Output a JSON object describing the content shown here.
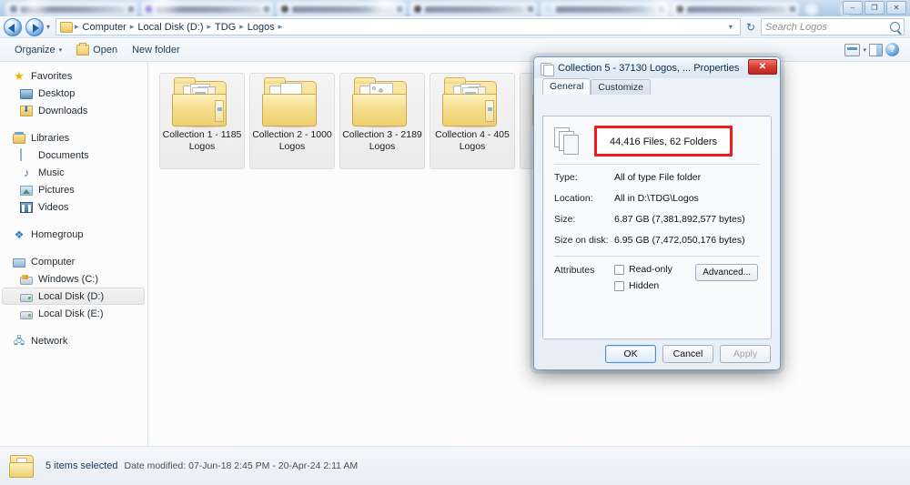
{
  "browser": {
    "window_controls": [
      "–",
      "❐",
      "✕"
    ],
    "tab_count": 6
  },
  "explorer": {
    "nav": {
      "back_icon": "back-arrow-icon",
      "forward_icon": "forward-arrow-icon",
      "history_caret": "▾",
      "breadcrumb": [
        "Computer",
        "Local Disk (D:)",
        "TDG",
        "Logos"
      ],
      "breadcrumb_separator": "▸",
      "address_caret": "▾",
      "refresh_icon": "↻",
      "search_placeholder": "Search Logos",
      "search_value": ""
    },
    "toolbar": {
      "organize_label": "Organize",
      "organize_caret": "▾",
      "open_label": "Open",
      "new_folder_label": "New folder",
      "view_caret": "▾"
    },
    "sidebar": {
      "groups": [
        {
          "header": {
            "label": "Favorites",
            "icon": "star-icon"
          },
          "items": [
            {
              "label": "Desktop",
              "icon": "desktop-icon"
            },
            {
              "label": "Downloads",
              "icon": "downloads-icon"
            }
          ]
        },
        {
          "header": {
            "label": "Libraries",
            "icon": "libraries-icon"
          },
          "items": [
            {
              "label": "Documents",
              "icon": "document-icon"
            },
            {
              "label": "Music",
              "icon": "music-icon"
            },
            {
              "label": "Pictures",
              "icon": "pictures-icon"
            },
            {
              "label": "Videos",
              "icon": "videos-icon"
            }
          ]
        },
        {
          "header": {
            "label": "Homegroup",
            "icon": "homegroup-icon"
          },
          "items": []
        },
        {
          "header": {
            "label": "Computer",
            "icon": "computer-icon"
          },
          "items": [
            {
              "label": "Windows (C:)",
              "icon": "windows-drive-icon",
              "selected": false
            },
            {
              "label": "Local Disk (D:)",
              "icon": "drive-icon",
              "selected": true
            },
            {
              "label": "Local Disk (E:)",
              "icon": "drive-icon",
              "selected": false
            }
          ]
        },
        {
          "header": {
            "label": "Network",
            "icon": "network-icon"
          },
          "items": []
        }
      ]
    },
    "items": [
      {
        "name": "Collection 1 - 1185 Logos",
        "selected": true,
        "style": "folder-with-logos"
      },
      {
        "name": "Collection 2 - 1000 Logos",
        "selected": true,
        "style": "folder-with-papers"
      },
      {
        "name": "Collection 3 - 2189 Logos",
        "selected": true,
        "style": "folder-with-papers"
      },
      {
        "name": "Collection 4 - 405 Logos",
        "selected": true,
        "style": "folder-with-logos"
      },
      {
        "name": "Collection 5 - 37130 Logos",
        "selected": true,
        "style": "folder-with-logos"
      }
    ],
    "statusbar": {
      "selection_text": "5 items selected",
      "date_modified": "Date modified: 07-Jun-18 2:45 PM - 20-Apr-24 2:11 AM"
    }
  },
  "dialog": {
    "title": "Collection 5 - 37130 Logos, ... Properties",
    "close_label": "✕",
    "tabs": [
      {
        "label": "General",
        "active": true
      },
      {
        "label": "Customize",
        "active": false
      }
    ],
    "summary": "44,416 Files, 62 Folders",
    "highlight_color": "#ef1b1b",
    "properties": [
      {
        "key": "Type:",
        "value": "All of type File folder"
      },
      {
        "key": "Location:",
        "value": "All in D:\\TDG\\Logos"
      },
      {
        "key": "Size:",
        "value": "6.87 GB (7,381,892,577 bytes)"
      },
      {
        "key": "Size on disk:",
        "value": "6.95 GB (7,472,050,176 bytes)"
      }
    ],
    "attributes": {
      "label": "Attributes",
      "checkboxes": [
        {
          "label": "Read-only",
          "checked": false
        },
        {
          "label": "Hidden",
          "checked": false
        }
      ],
      "advanced_label": "Advanced..."
    },
    "buttons": [
      {
        "label": "OK",
        "state": "primary"
      },
      {
        "label": "Cancel",
        "state": "normal"
      },
      {
        "label": "Apply",
        "state": "disabled"
      }
    ]
  }
}
